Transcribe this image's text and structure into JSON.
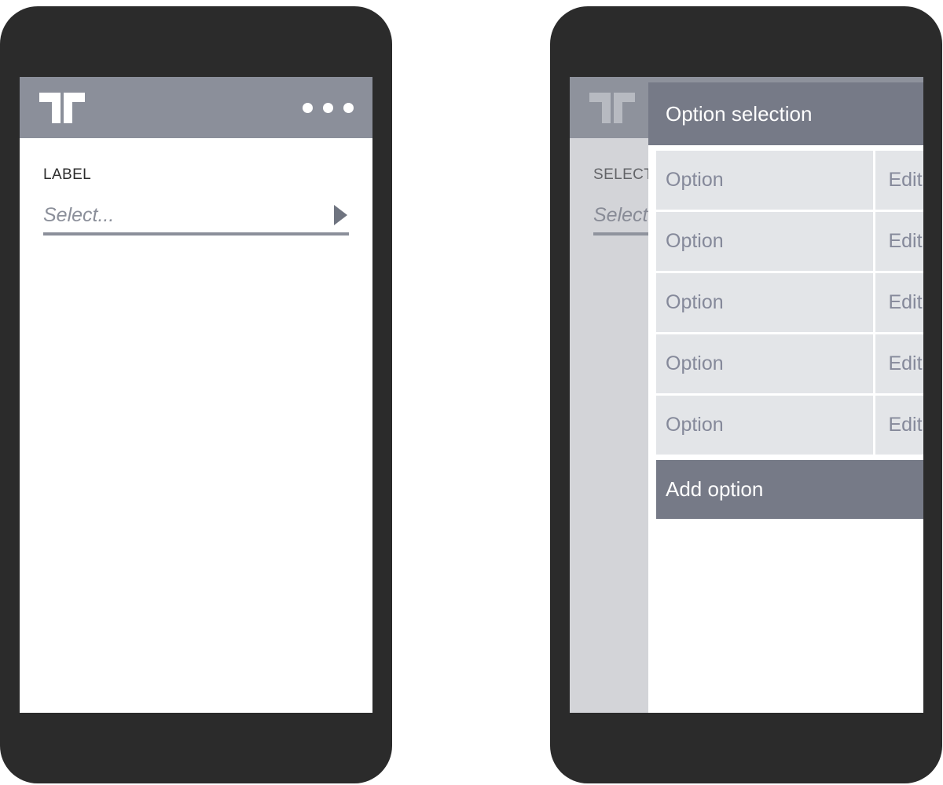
{
  "appbar": {
    "logo_icon": "brand-double-t-logo",
    "overflow_icon": "overflow-menu-dots-icon",
    "dots": [
      "dot",
      "dot",
      "dot"
    ],
    "bar_color": "#8b8f9a"
  },
  "phone_left": {
    "form": {
      "label": "LABEL",
      "select_value": "Select...",
      "select_placeholder": "Select...",
      "caret_icon": "play-triangle-right-icon",
      "underline_color": "#8b8f9a"
    }
  },
  "phone_right": {
    "background_form": {
      "label": "SELECT",
      "select_value": "Select...",
      "select_placeholder": "Select..."
    },
    "dialog": {
      "title": "Option selection",
      "header_color": "#767a87",
      "row_color": "#e3e5e8",
      "row_text_color": "#85899a",
      "options": [
        {
          "name": "Option",
          "edit": "Edit"
        },
        {
          "name": "Option",
          "edit": "Edit"
        },
        {
          "name": "Option",
          "edit": "Edit"
        },
        {
          "name": "Option",
          "edit": "Edit"
        },
        {
          "name": "Option",
          "edit": "Edit"
        }
      ],
      "add_option_label": "Add option"
    }
  }
}
